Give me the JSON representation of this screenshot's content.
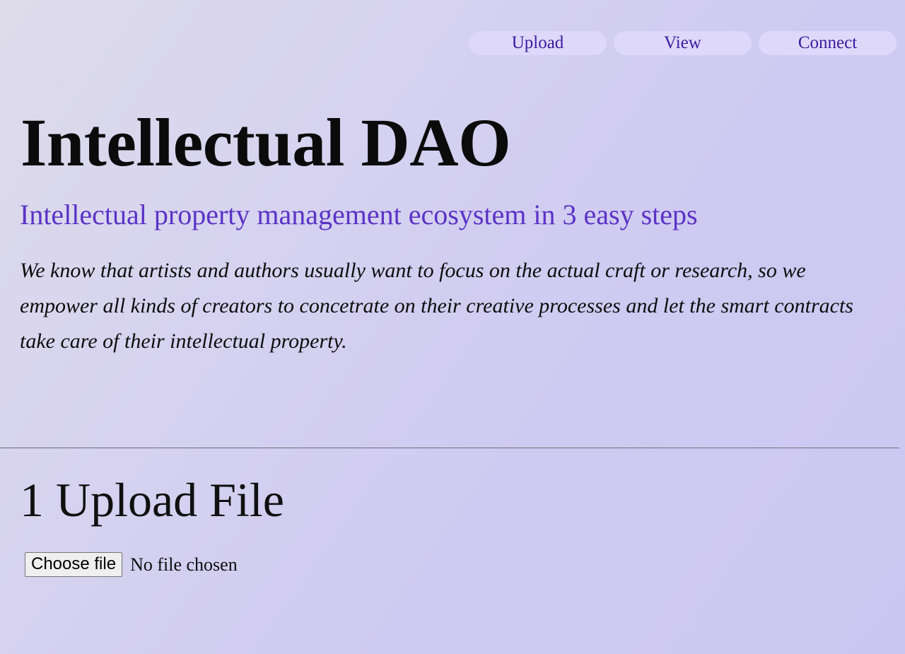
{
  "theme": {
    "background_top_left": "#dedcea",
    "background_bottom_right": "#ccc7f2",
    "accent_purple": "#5b33c6",
    "nav_pill_background": "#ded9fb",
    "nav_pill_text": "#3b1a9e",
    "divider_color": "#6d6d75"
  },
  "nav": {
    "items": [
      {
        "label": "Upload",
        "name": "nav-upload"
      },
      {
        "label": "View",
        "name": "nav-view"
      },
      {
        "label": "Connect",
        "name": "nav-connect"
      }
    ]
  },
  "hero": {
    "title": "Intellectual DAO",
    "subtitle": "Intellectual property management ecosystem in 3 easy steps",
    "paragraph": "We know that artists and authors usually want to focus on the actual craft or research, so we empower all kinds of creators to concetrate on their creative processes and let the smart contracts take care of their intellectual property."
  },
  "upload": {
    "step_number": "1",
    "heading": "1 Upload File",
    "choose_file_label": "Choose file",
    "file_status": "No file chosen"
  }
}
